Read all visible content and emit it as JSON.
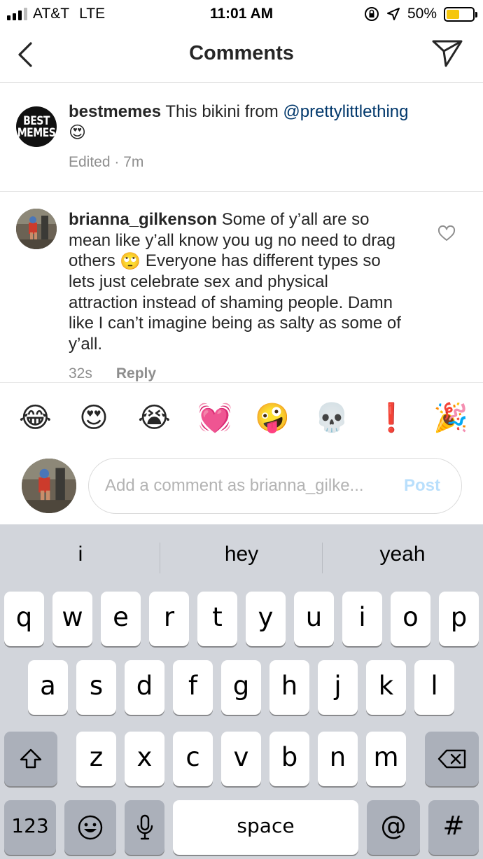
{
  "status_bar": {
    "carrier": "AT&T",
    "network": "LTE",
    "time": "11:01 AM",
    "battery": "50%",
    "battery_fraction": 0.5,
    "icons": [
      "signal-icon",
      "orientation-lock-icon",
      "location-arrow-icon",
      "battery-icon"
    ]
  },
  "nav": {
    "title": "Comments",
    "back_icon": "chevron-left-icon",
    "send_icon": "paper-plane-icon"
  },
  "caption": {
    "avatar_text_line1": "BEST",
    "avatar_text_line2": "MEMES",
    "username": "bestmemes",
    "text": "This bikini from ",
    "mention": "@prettylittlething",
    "emoji": "😍",
    "meta": "Edited · 7m"
  },
  "comment": {
    "username": "brianna_gilkenson",
    "text_part1": "Some of y’all are so mean like y’all know you ug no need to drag others ",
    "emoji": "🙄",
    "text_part2": " Everyone has different types so lets just celebrate sex and physical attraction instead of shaming people. Damn like I can’t imagine being as salty as some of y’all.",
    "time": "32s",
    "reply_label": "Reply",
    "like_icon": "heart-outline-icon"
  },
  "emoji_bar": [
    "😂",
    "😍",
    "😭",
    "💓",
    "🤪",
    "💀",
    "❗",
    "🎉"
  ],
  "input": {
    "placeholder": "Add a comment as brianna_gilke...",
    "post_label": "Post"
  },
  "keyboard": {
    "suggestions": [
      "i",
      "hey",
      "yeah"
    ],
    "row1": [
      "q",
      "w",
      "e",
      "r",
      "t",
      "y",
      "u",
      "i",
      "o",
      "p"
    ],
    "row2": [
      "a",
      "s",
      "d",
      "f",
      "g",
      "h",
      "j",
      "k",
      "l"
    ],
    "row3": [
      "z",
      "x",
      "c",
      "v",
      "b",
      "n",
      "m"
    ],
    "numbers_label": "123",
    "space_label": "space",
    "at_label": "@",
    "hash_label": "#",
    "special_keys": [
      "shift-icon",
      "backspace-icon",
      "emoji-keyboard-icon",
      "microphone-icon"
    ]
  },
  "colors": {
    "mention": "#00376b",
    "post_disabled": "#b9dffc",
    "battery": "#f5c60c",
    "keyboard_bg": "#d2d5db"
  }
}
